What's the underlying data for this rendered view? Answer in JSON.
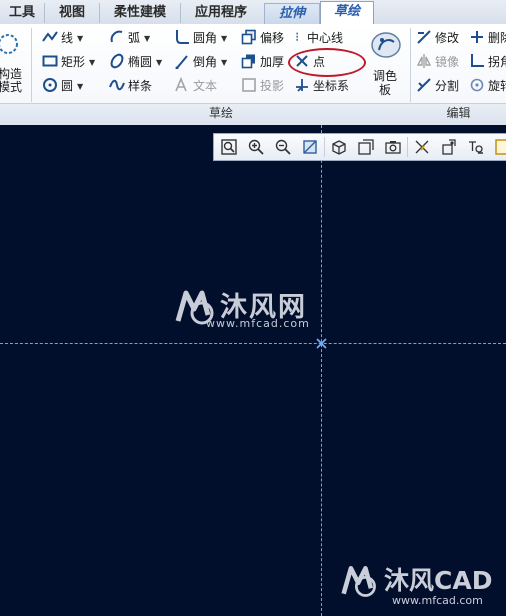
{
  "tabs": [
    {
      "label": "工具"
    },
    {
      "label": "视图"
    },
    {
      "label": "柔性建模"
    },
    {
      "label": "应用程序"
    },
    {
      "label": "拉伸"
    },
    {
      "label": "草绘"
    }
  ],
  "ribbon": {
    "left_partial": {
      "line1": "构造",
      "line2": "模式"
    },
    "col1": {
      "line": "线",
      "rect": "矩形",
      "circle": "圆"
    },
    "col2": {
      "arc": "弧",
      "ellipse": "椭圆",
      "spline": "样条"
    },
    "col3": {
      "fillet": "圆角",
      "chamfer": "倒角",
      "text": "文本"
    },
    "col4": {
      "offset": "偏移",
      "thicken": "加厚",
      "project": "投影"
    },
    "col5": {
      "centerline": "中心线",
      "point": "点",
      "csys": "坐标系"
    },
    "palette": {
      "line1": "调色",
      "line2": "板"
    },
    "edit": {
      "modify": "修改",
      "mirror": "镜像",
      "divide": "分割",
      "delete": "删除",
      "corner": "拐角",
      "rotate": "旋转"
    },
    "group_sketch": "草绘",
    "group_edit": "编辑"
  },
  "watermark": {
    "brand_cn": "沐风网",
    "brand_url": "www.mfcad.com",
    "brand2": "沐风CAD",
    "brand2_url": "www.mfcad.com"
  },
  "colors": {
    "canvas_bg": "#010f2c",
    "highlight": "#c0192a",
    "accent": "#2b5fae"
  }
}
